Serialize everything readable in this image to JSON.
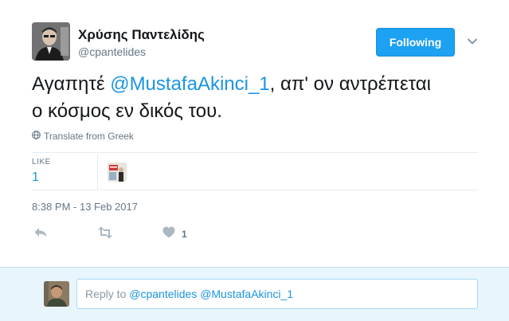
{
  "author": {
    "name": "Χρύσης Παντελίδης",
    "handle": "@cpantelides"
  },
  "follow_button": {
    "label": "Following"
  },
  "tweet": {
    "text_prefix": "Αγαπητέ ",
    "mention": "@MustafaAkinci_1",
    "text_line1_suffix": ", απ' ον αντρέπεται",
    "text_line2": "ο κόσμος εν δικός του."
  },
  "translate": {
    "label": "Translate from Greek",
    "icon": "globe-icon"
  },
  "stats": {
    "like_label": "LIKE",
    "like_count": "1"
  },
  "timestamp": "8:38 PM - 13 Feb 2017",
  "actions": {
    "reply_icon": "reply-icon",
    "retweet_icon": "retweet-icon",
    "like_icon": "heart-icon",
    "like_count": "1"
  },
  "reply": {
    "prefix": "Reply to ",
    "mention1": "@cpantelides",
    "mention2": "@MustafaAkinci_1"
  },
  "colors": {
    "accent": "#1da1f2",
    "link": "#1b95e0",
    "muted": "#657786",
    "reply_bg": "#e8f5fd"
  }
}
